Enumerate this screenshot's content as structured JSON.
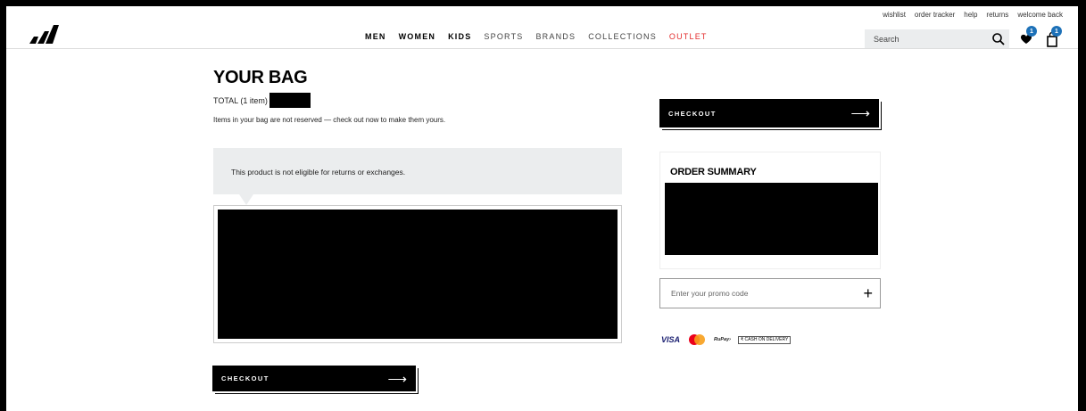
{
  "header": {
    "utility_links": [
      "wishlist",
      "order tracker",
      "help",
      "returns",
      "welcome back"
    ],
    "nav": [
      {
        "label": "MEN",
        "style": "bold"
      },
      {
        "label": "WOMEN",
        "style": "bold"
      },
      {
        "label": "KIDS",
        "style": "bold"
      },
      {
        "label": "SPORTS",
        "style": "light"
      },
      {
        "label": "BRANDS",
        "style": "light"
      },
      {
        "label": "COLLECTIONS",
        "style": "light"
      },
      {
        "label": "OUTLET",
        "style": "sale",
        "color": "#e32b2b"
      }
    ],
    "search_placeholder": "Search",
    "wishlist_count": "1",
    "bag_count": "1"
  },
  "bag": {
    "title": "YOUR BAG",
    "total_label": "TOTAL (1 item)",
    "reserved_note": "Items in your bag are not reserved — check out now to make them yours.",
    "notice": "This product is not eligible for returns or exchanges."
  },
  "checkout_label": "CHECKOUT",
  "summary": {
    "title": "ORDER SUMMARY"
  },
  "promo": {
    "placeholder": "Enter your promo code"
  },
  "payments": {
    "visa": "VISA",
    "rupay": "RuPay›",
    "cod": "₹ CASH ON DELIVERY"
  },
  "colors": {
    "accent_badge": "#1d71b8",
    "outlet": "#e32b2b",
    "panel_gray": "#ebedee"
  }
}
